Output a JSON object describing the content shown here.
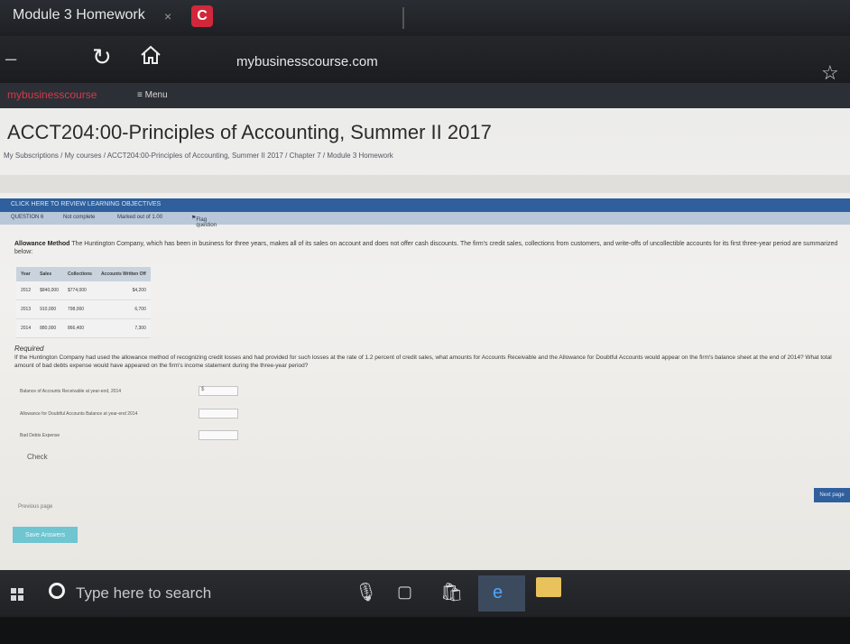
{
  "browser": {
    "tab_title": "Module 3 Homework",
    "tab_close": "×",
    "favicon_letter": "C",
    "url": "mybusinesscourse.com"
  },
  "site": {
    "brand": "mybusinesscourse",
    "menu": "≡ Menu"
  },
  "page": {
    "title": "ACCT204:00-Principles of Accounting, Summer II 2017",
    "breadcrumb": "My Subscriptions / My courses / ACCT204:00-Principles of Accounting, Summer II 2017 / Chapter 7 / Module 3 Homework",
    "objectives_link": "CLICK HERE TO REVIEW LEARNING OBJECTIVES",
    "question_bar": {
      "question": "QUESTION 6",
      "status": "Not complete",
      "marked": "Marked out of 1.00",
      "flag": "Flag question"
    },
    "question": {
      "heading": "Allowance Method",
      "text": " The Huntington Company, which has been in business for three years, makes all of its sales on account and does not offer cash discounts. The firm's credit sales, collections from customers, and write-offs of uncollectible accounts for its first three-year period are summarized below:"
    },
    "table": {
      "headers": [
        "Year",
        "Sales",
        "Collections",
        "Accounts Written Off"
      ],
      "rows": [
        [
          "2012",
          "$840,000",
          "$774,000",
          "$4,200"
        ],
        [
          "2013",
          "910,000",
          "798,000",
          "6,700"
        ],
        [
          "2014",
          "880,000",
          "866,400",
          "7,300"
        ]
      ]
    },
    "required_label": "Required",
    "required_text": "If the Huntington Company had used the allowance method of recognizing credit losses and had provided for such losses at the rate of 1.2 percent of credit sales, what amounts for Accounts Receivable and the Allowance for Doubtful Accounts would appear on the firm's balance sheet at the end of 2014? What total amount of bad debts expense would have appeared on the firm's income statement during the three-year period?",
    "fields": [
      {
        "label": "Balance of Accounts Receivable at year-end, 2014",
        "prefix": "$"
      },
      {
        "label": "Allowance for Doubtful Accounts Balance at year-end 2014",
        "prefix": ""
      },
      {
        "label": "Bad Debts Expense",
        "prefix": ""
      }
    ],
    "check": "Check",
    "previous": "Previous page",
    "save": "Save Answers",
    "next": "Next page"
  },
  "taskbar": {
    "search_placeholder": "Type here to search"
  }
}
